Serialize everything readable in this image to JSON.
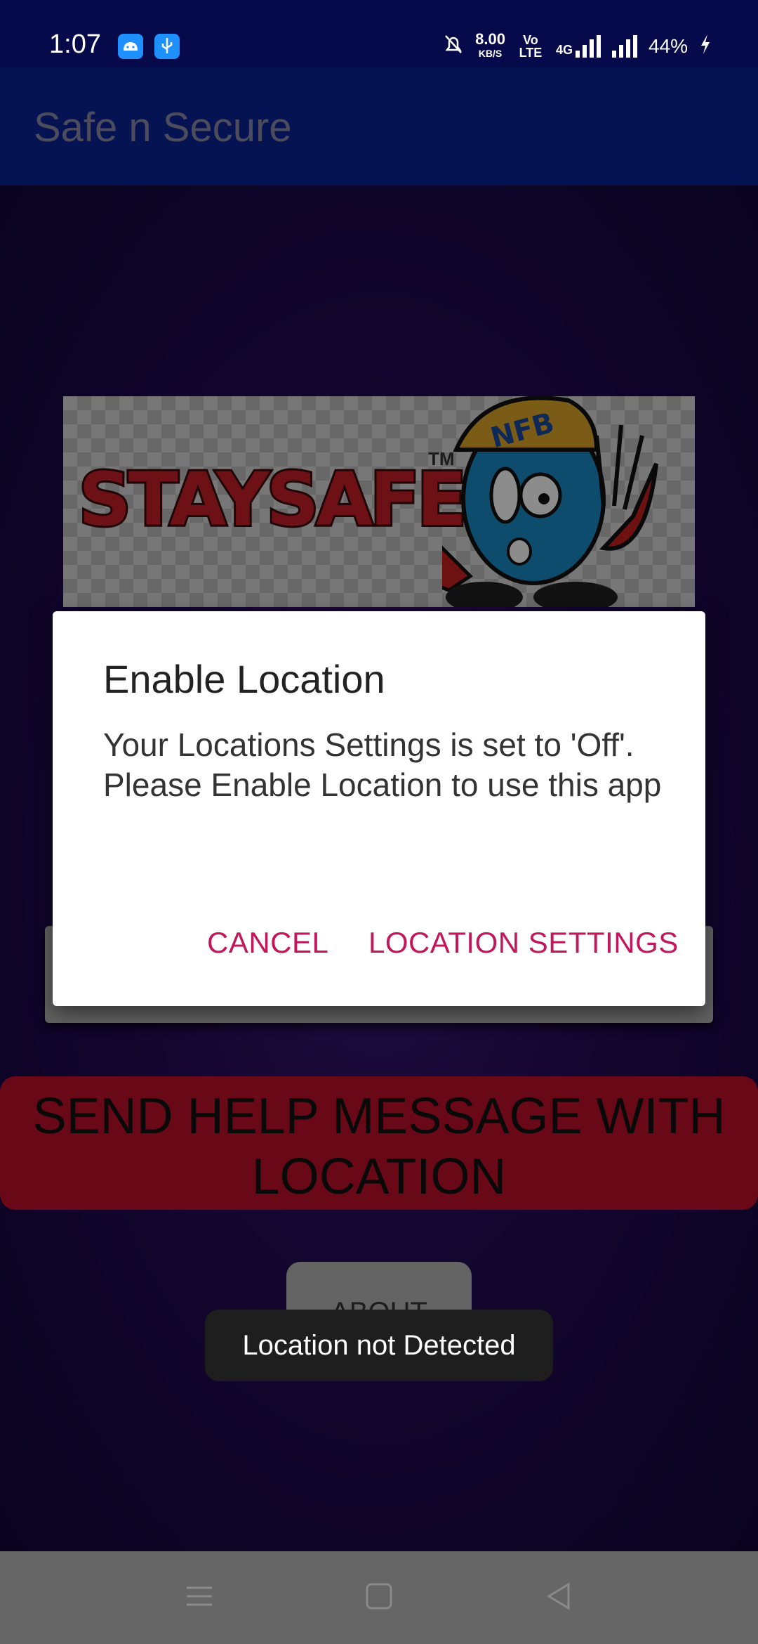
{
  "status_bar": {
    "time": "1:07",
    "speed_value": "8.00",
    "speed_unit": "KB/S",
    "volte": "Vo LTE",
    "network": "4G",
    "battery": "44%",
    "icons": [
      "android-icon",
      "usb-icon",
      "mute-icon",
      "signal-icon",
      "battery-charging-icon"
    ]
  },
  "app_bar": {
    "title": "Safe n Secure"
  },
  "banner": {
    "text": "STAYSAFE",
    "trademark": "TM",
    "helmet_text": "NFB"
  },
  "main": {
    "send_button_label": "SEND HELP MESSAGE WITH LOCATION",
    "about_button_label": "ABOUT"
  },
  "dialog": {
    "title": "Enable Location",
    "message": "Your Locations Settings is set to 'Off'.\nPlease Enable Location to use this app",
    "cancel_label": "CANCEL",
    "settings_label": "LOCATION SETTINGS"
  },
  "toast": {
    "text": "Location not Detected"
  },
  "nav_bar": {
    "icons": [
      "menu-icon",
      "home-icon",
      "back-icon"
    ]
  },
  "colors": {
    "status_bar": "#060a4a",
    "app_bar": "#0a2396",
    "dialog_button": "#c2185b",
    "send_button": "#c0102a"
  }
}
